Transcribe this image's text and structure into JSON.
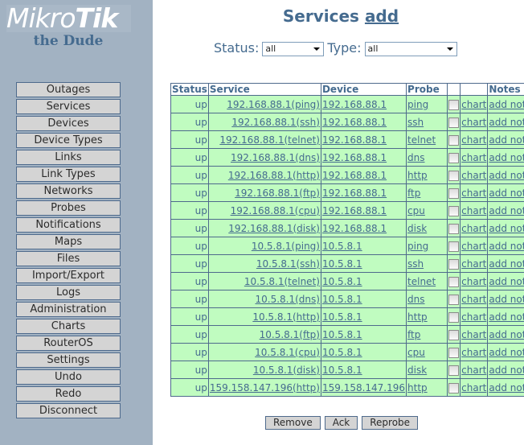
{
  "brand": {
    "logo_left": "Mikro",
    "logo_right": "Tik",
    "subtitle": "the Dude"
  },
  "sidebar": {
    "items": [
      {
        "label": "Outages"
      },
      {
        "label": "Services"
      },
      {
        "label": "Devices"
      },
      {
        "label": "Device Types"
      },
      {
        "label": "Links"
      },
      {
        "label": "Link Types"
      },
      {
        "label": "Networks"
      },
      {
        "label": "Probes"
      },
      {
        "label": "Notifications"
      },
      {
        "label": "Maps"
      },
      {
        "label": "Files"
      },
      {
        "label": "Import/Export"
      },
      {
        "label": "Logs"
      },
      {
        "label": "Administration"
      },
      {
        "label": "Charts"
      },
      {
        "label": "RouterOS"
      },
      {
        "label": "Settings"
      },
      {
        "label": "Undo"
      },
      {
        "label": "Redo"
      },
      {
        "label": "Disconnect"
      }
    ]
  },
  "header": {
    "title": "Services",
    "add_link": "add"
  },
  "filters": {
    "status_label": "Status:",
    "status_value": "all",
    "type_label": "Type:",
    "type_value": "all"
  },
  "table": {
    "columns": [
      "Status",
      "Service",
      "Device",
      "Probe",
      "",
      "",
      "Notes"
    ],
    "rows": [
      {
        "status": "up",
        "service": "192.168.88.1(ping)",
        "device": "192.168.88.1",
        "probe": "ping",
        "chart": "chart",
        "note": "add note"
      },
      {
        "status": "up",
        "service": "192.168.88.1(ssh)",
        "device": "192.168.88.1",
        "probe": "ssh",
        "chart": "chart",
        "note": "add note"
      },
      {
        "status": "up",
        "service": "192.168.88.1(telnet)",
        "device": "192.168.88.1",
        "probe": "telnet",
        "chart": "chart",
        "note": "add note"
      },
      {
        "status": "up",
        "service": "192.168.88.1(dns)",
        "device": "192.168.88.1",
        "probe": "dns",
        "chart": "chart",
        "note": "add note"
      },
      {
        "status": "up",
        "service": "192.168.88.1(http)",
        "device": "192.168.88.1",
        "probe": "http",
        "chart": "chart",
        "note": "add note"
      },
      {
        "status": "up",
        "service": "192.168.88.1(ftp)",
        "device": "192.168.88.1",
        "probe": "ftp",
        "chart": "chart",
        "note": "add note"
      },
      {
        "status": "up",
        "service": "192.168.88.1(cpu)",
        "device": "192.168.88.1",
        "probe": "cpu",
        "chart": "chart",
        "note": "add note"
      },
      {
        "status": "up",
        "service": "192.168.88.1(disk)",
        "device": "192.168.88.1",
        "probe": "disk",
        "chart": "chart",
        "note": "add note"
      },
      {
        "status": "up",
        "service": "10.5.8.1(ping)",
        "device": "10.5.8.1",
        "probe": "ping",
        "chart": "chart",
        "note": "add note"
      },
      {
        "status": "up",
        "service": "10.5.8.1(ssh)",
        "device": "10.5.8.1",
        "probe": "ssh",
        "chart": "chart",
        "note": "add note"
      },
      {
        "status": "up",
        "service": "10.5.8.1(telnet)",
        "device": "10.5.8.1",
        "probe": "telnet",
        "chart": "chart",
        "note": "add note"
      },
      {
        "status": "up",
        "service": "10.5.8.1(dns)",
        "device": "10.5.8.1",
        "probe": "dns",
        "chart": "chart",
        "note": "add note"
      },
      {
        "status": "up",
        "service": "10.5.8.1(http)",
        "device": "10.5.8.1",
        "probe": "http",
        "chart": "chart",
        "note": "add note"
      },
      {
        "status": "up",
        "service": "10.5.8.1(ftp)",
        "device": "10.5.8.1",
        "probe": "ftp",
        "chart": "chart",
        "note": "add note"
      },
      {
        "status": "up",
        "service": "10.5.8.1(cpu)",
        "device": "10.5.8.1",
        "probe": "cpu",
        "chart": "chart",
        "note": "add note"
      },
      {
        "status": "up",
        "service": "10.5.8.1(disk)",
        "device": "10.5.8.1",
        "probe": "disk",
        "chart": "chart",
        "note": "add note"
      },
      {
        "status": "up",
        "service": "159.158.147.196(http)",
        "device": "159.158.147.196",
        "probe": "http",
        "chart": "chart",
        "note": "add note"
      }
    ]
  },
  "actions": {
    "remove": "Remove",
    "ack": "Ack",
    "reprobe": "Reprobe"
  },
  "colors": {
    "accent": "#456b8f",
    "sidebar_bg": "#a2b2c2",
    "row_bg": "#c0fcc0",
    "border": "#4e6a8c"
  }
}
